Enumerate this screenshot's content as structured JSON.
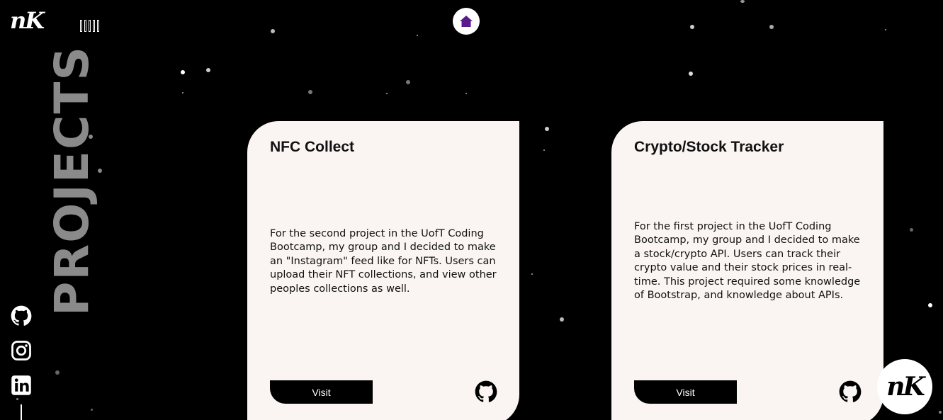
{
  "header": {
    "logo_text": "nK",
    "sound_toggle_icon": "sound-bars-icon",
    "home_icon": "home-icon",
    "home_icon_color": "#5b1a8c"
  },
  "page_title": "PROJECTS",
  "social": [
    {
      "name": "github",
      "icon": "github-icon"
    },
    {
      "name": "instagram",
      "icon": "instagram-icon"
    },
    {
      "name": "linkedin",
      "icon": "linkedin-icon"
    }
  ],
  "projects": [
    {
      "title": "NFC Collect",
      "description": "For the second project in the UofT Coding Bootcamp, my group and I decided to make an \"Instagram\" feed like for NFTs. Users can upload their NFT collections, and view other peoples collections as well.",
      "visit_label": "Visit",
      "repo_icon": "github-icon"
    },
    {
      "title": "Crypto/Stock Tracker",
      "description": "For the first project in the UofT Coding Bootcamp, my group and I decided to make a stock/crypto API. Users can track their crypto value and their stock prices in real-time. This project required some knowledge of Bootstrap, and knowledge about APIs.",
      "visit_label": "Visit",
      "repo_icon": "github-icon"
    }
  ],
  "corner_logo_text": "nK",
  "colors": {
    "background": "#000000",
    "card": "#faf5f2",
    "title_gray": "#8a8a8a",
    "accent": "#5b1a8c"
  }
}
